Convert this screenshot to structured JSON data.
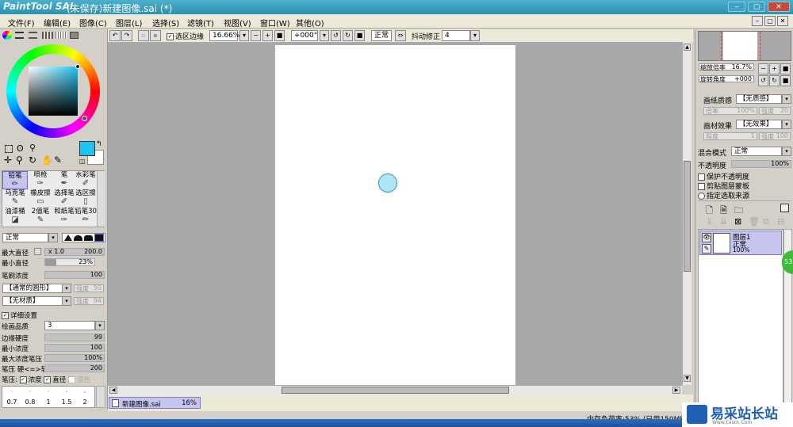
{
  "window": {
    "app_logo": "PaintTool SAI",
    "title": "(未保存)新建图像.sai (*)",
    "minimize_label": "‒",
    "maximize_label": "▢",
    "close_label": "✕"
  },
  "menu": [
    "文件(F)",
    "编辑(E)",
    "图像(C)",
    "图层(L)",
    "选择(S)",
    "滤镜(T)",
    "视图(V)",
    "窗口(W)",
    "其他(O)"
  ],
  "toolbar": {
    "selection_edge_label": "选区边缘",
    "zoom_value": "16.66%",
    "rotation_value": "+000°",
    "blend_label": "正常",
    "stabilizer_label": "抖动修正",
    "stabilizer_value": "4"
  },
  "colors": {
    "main_color": "#1ec4f0",
    "sub_color": "#ffffff",
    "accent": "#3aa6c8"
  },
  "tools": [
    {
      "label": "铅笔",
      "icon": "pencil-icon"
    },
    {
      "label": "喷枪",
      "icon": "airbrush-icon"
    },
    {
      "label": "笔",
      "icon": "pen-icon"
    },
    {
      "label": "水彩笔",
      "icon": "watercolor-icon"
    },
    {
      "label": "马克笔",
      "icon": "marker-icon"
    },
    {
      "label": "橡皮擦",
      "icon": "eraser-icon"
    },
    {
      "label": "选择笔",
      "icon": "select-pen-icon"
    },
    {
      "label": "选区擦",
      "icon": "select-eraser-icon"
    },
    {
      "label": "油漆桶",
      "icon": "bucket-icon"
    },
    {
      "label": "2值笔",
      "icon": "binary-pen-icon"
    },
    {
      "label": "和纸笔",
      "icon": "washi-pen-icon"
    },
    {
      "label": "铅笔30",
      "icon": "pencil-icon"
    }
  ],
  "brush": {
    "blend_mode": "正常",
    "max_size_label": "最大直径",
    "max_size_multiplier": "x 1.0",
    "max_size_value": "200.0",
    "min_size_label": "最小直径",
    "min_size_value": "23%",
    "min_size_fraction": 0.23,
    "density_label": "笔刷浓度",
    "density_value": "100",
    "density_fraction": 1.0,
    "shape_value": "【通常的圆形】",
    "shape_strength_label": "强度",
    "shape_strength_value": "50",
    "texture_value": "【无材质】",
    "texture_strength_label": "强度",
    "texture_strength_value": "94",
    "detail_label": "详细设置",
    "quality_label": "绘画品质",
    "quality_value": "3",
    "edge_hardness_label": "边缘硬度",
    "edge_hardness_value": "99",
    "min_density_label": "最小浓度",
    "min_density_value": "100",
    "max_density_pressure_label": "最大浓度笔压",
    "max_density_pressure_value": "100%",
    "pressure_label": "笔压 硬<=>软",
    "pressure_value": "200",
    "pressure_options_label": "笔压:",
    "pressure_density_label": "浓度",
    "pressure_size_label": "直径",
    "pressure_blend_label": "混色",
    "size_presets": [
      "0.7",
      "0.8",
      "1",
      "1.5",
      "2"
    ]
  },
  "navigator": {
    "zoom_label": "缩放倍率",
    "zoom_value": "16.7%",
    "rotation_label": "旋转角度",
    "rotation_value": "+000"
  },
  "layer_panel": {
    "paper_texture_label": "画纸质感",
    "paper_texture_value": "【无质感】",
    "paper_scale_label": "倍率",
    "paper_scale_value": "100%",
    "paper_strength_label": "强度",
    "paper_strength_value": "20",
    "paper_effect_label": "画材效果",
    "paper_effect_value": "【无效果】",
    "effect_degree_label": "程度",
    "effect_degree_value": "1",
    "effect_strength_label": "强度",
    "effect_strength_value": "100",
    "blend_mode_label": "混合模式",
    "blend_mode_value": "正常",
    "opacity_label": "不透明度",
    "opacity_value": "100%",
    "preserve_opacity_label": "保护不透明度",
    "clipping_label": "剪贴图层蒙板",
    "selection_source_label": "指定选取来源",
    "layers": [
      {
        "name": "图层1",
        "mode": "正常",
        "opacity": "100%"
      }
    ]
  },
  "document_tab": {
    "name": "新建图像.sai",
    "zoom": "16%"
  },
  "status": {
    "memory_text": "内存负荷率:53% (已用150MB/可用"
  },
  "watermark": {
    "site_name": "易采站长站",
    "site_url": "Www.Easck.Com"
  },
  "badge": {
    "value": "53"
  }
}
